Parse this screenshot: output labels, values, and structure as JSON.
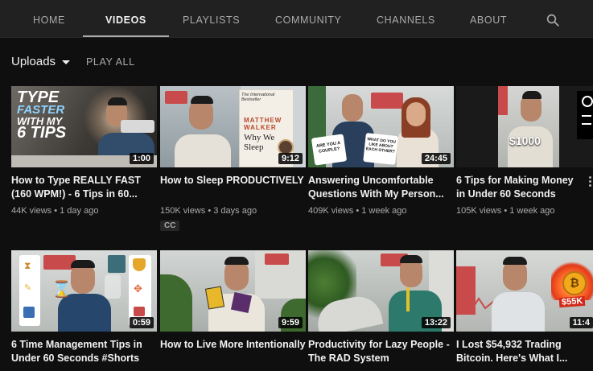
{
  "nav": {
    "tabs": [
      {
        "label": "HOME"
      },
      {
        "label": "VIDEOS",
        "active": true
      },
      {
        "label": "PLAYLISTS"
      },
      {
        "label": "COMMUNITY"
      },
      {
        "label": "CHANNELS"
      },
      {
        "label": "ABOUT"
      }
    ],
    "search_icon": "search-icon"
  },
  "toolbar": {
    "uploads_label": "Uploads",
    "play_all_label": "PLAY ALL"
  },
  "videos": [
    {
      "title": "How to Type REALLY FAST (160 WPM!) - 6 Tips in 60...",
      "views": "44K views",
      "age": "1 day ago",
      "duration": "1:00",
      "thumb_text": [
        "TYPE",
        "FASTER",
        "WITH MY",
        "6 TIPS"
      ]
    },
    {
      "title": "How to Sleep PRODUCTIVELY",
      "views": "150K views",
      "age": "3 days ago",
      "duration": "9:12",
      "badge": "CC",
      "thumb_text": [
        "The International Bestseller",
        "MATTHEW",
        "WALKER",
        "Why We",
        "Sleep"
      ]
    },
    {
      "title": "Answering Uncomfortable Questions With My Person...",
      "views": "409K views",
      "age": "1 week ago",
      "duration": "24:45",
      "thumb_text": [
        "ARE YOU A COUPLE?",
        "WHAT DO YOU LIKE ABOUT EACH OTHER?"
      ]
    },
    {
      "title": "6 Tips for Making Money in Under 60 Seconds #Shorts",
      "views": "105K views",
      "age": "1 week ago",
      "duration": "",
      "thumb_text": [
        "$1000"
      ]
    },
    {
      "title": "6 Time Management Tips in Under 60 Seconds #Shorts",
      "views": "",
      "age": "",
      "duration": "0:59",
      "thumb_text": []
    },
    {
      "title": "How to Live More Intentionally",
      "views": "",
      "age": "",
      "duration": "9:59",
      "thumb_text": []
    },
    {
      "title": "Productivity for Lazy People - The RAD System",
      "views": "",
      "age": "",
      "duration": "13:22",
      "thumb_text": []
    },
    {
      "title": "I Lost $54,932 Trading Bitcoin. Here's What I...",
      "views": "",
      "age": "",
      "duration": "11:4",
      "thumb_text": [
        "$55K"
      ]
    }
  ],
  "separator": "•"
}
